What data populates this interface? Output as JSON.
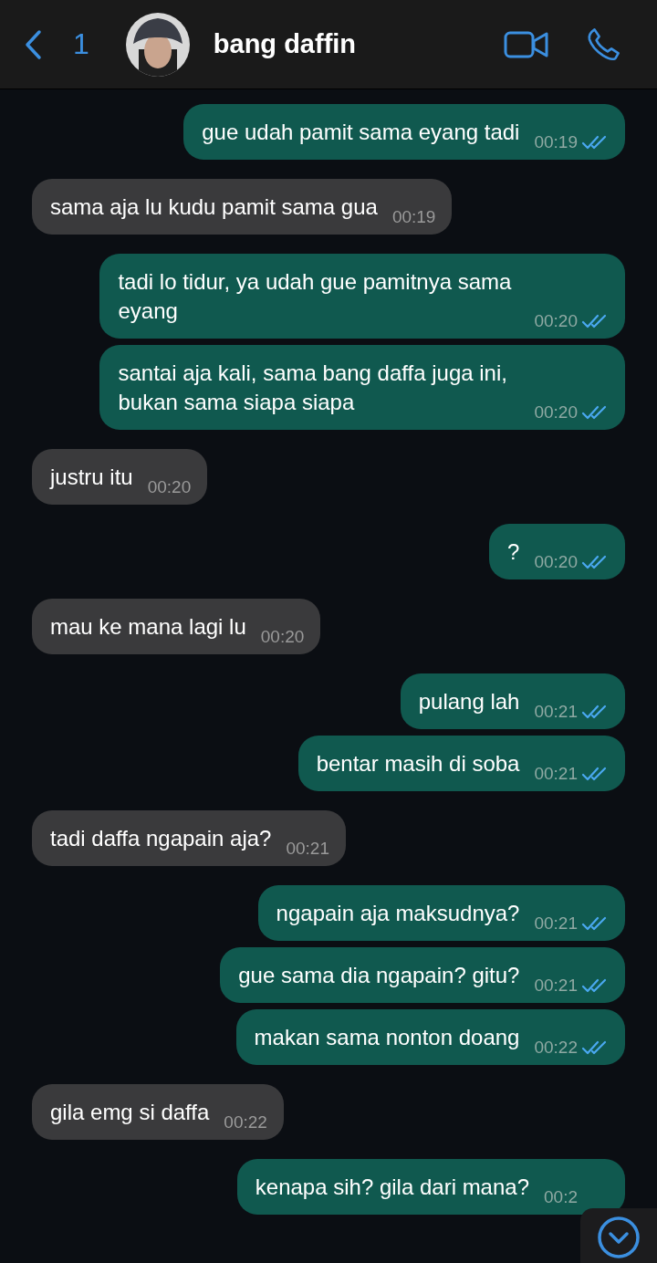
{
  "header": {
    "back_count": "1",
    "contact_name": "bang daffin"
  },
  "messages": [
    {
      "kind": "outgoing",
      "text": "gue udah pamit sama eyang tadi",
      "time": "00:19",
      "read": true
    },
    {
      "kind": "incoming",
      "text": "sama aja lu kudu pamit sama gua",
      "time": "00:19"
    },
    {
      "kind": "outgoing",
      "text": "tadi lo tidur, ya udah gue pamitnya sama eyang",
      "time": "00:20",
      "read": true
    },
    {
      "kind": "outgoing",
      "text": "santai aja kali, sama bang daffa juga ini, bukan sama siapa siapa",
      "time": "00:20",
      "read": true
    },
    {
      "kind": "incoming",
      "text": "justru itu",
      "time": "00:20"
    },
    {
      "kind": "outgoing",
      "text": "?",
      "time": "00:20",
      "read": true
    },
    {
      "kind": "incoming",
      "text": "mau ke mana lagi lu",
      "time": "00:20"
    },
    {
      "kind": "outgoing",
      "text": "pulang lah",
      "time": "00:21",
      "read": true
    },
    {
      "kind": "outgoing",
      "text": "bentar masih di soba",
      "time": "00:21",
      "read": true
    },
    {
      "kind": "incoming",
      "text": "tadi daffa ngapain aja?",
      "time": "00:21"
    },
    {
      "kind": "outgoing",
      "text": "ngapain aja maksudnya?",
      "time": "00:21",
      "read": true
    },
    {
      "kind": "outgoing",
      "text": "gue sama dia ngapain? gitu?",
      "time": "00:21",
      "read": true
    },
    {
      "kind": "outgoing",
      "text": "makan sama nonton doang",
      "time": "00:22",
      "read": true
    },
    {
      "kind": "incoming",
      "text": "gila emg si daffa",
      "time": "00:22"
    },
    {
      "kind": "outgoing",
      "text": "kenapa sih? gila dari mana?",
      "time": "00:2"
    }
  ]
}
